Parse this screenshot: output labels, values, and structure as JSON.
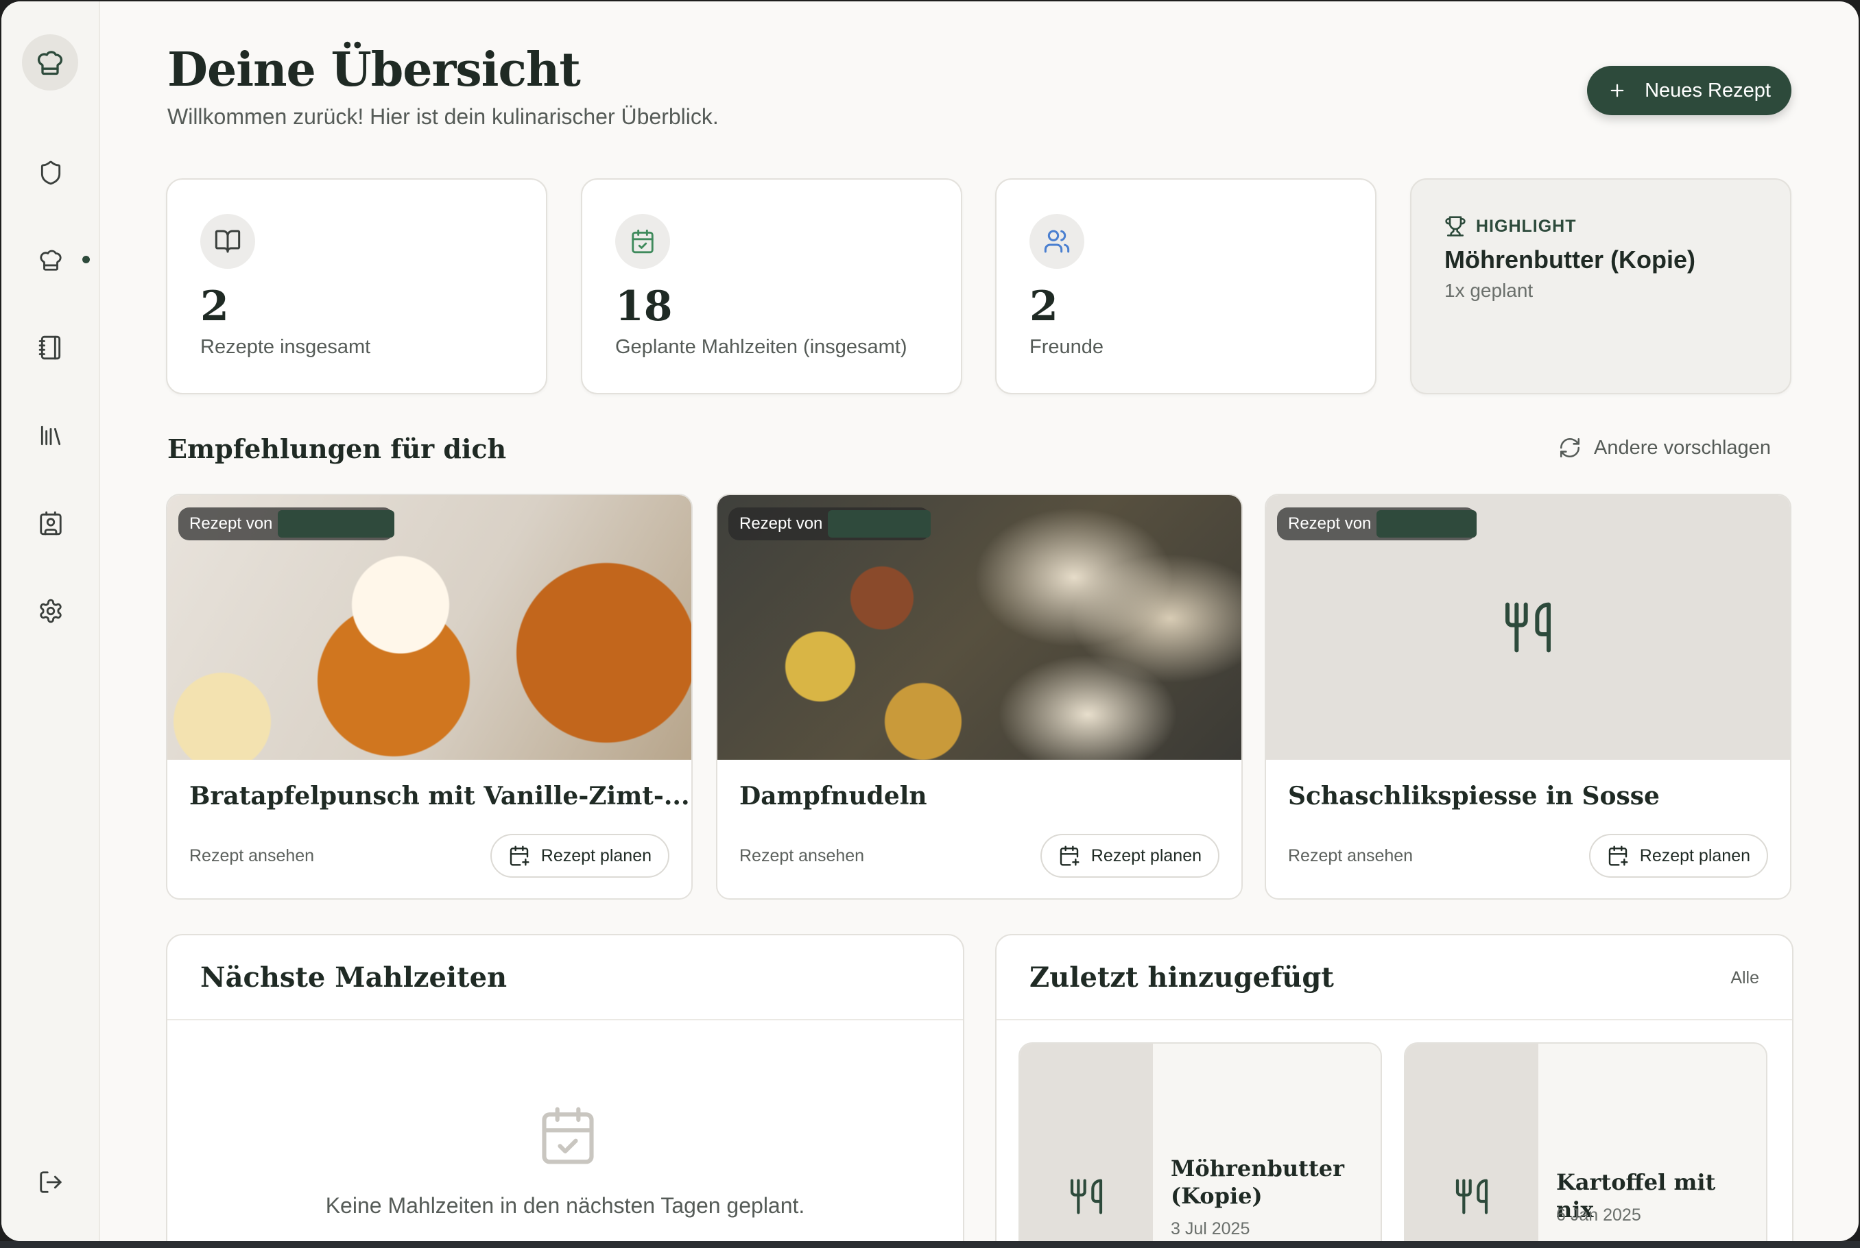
{
  "header": {
    "title": "Deine Übersicht",
    "subtitle": "Willkommen zurück! Hier ist dein kulinarischer Überblick.",
    "new_recipe_label": "Neues Rezept"
  },
  "sidebar": {
    "items": [
      {
        "icon": "shield-icon"
      },
      {
        "icon": "chef-hat-icon",
        "active": true
      },
      {
        "icon": "notebook-icon"
      },
      {
        "icon": "library-icon"
      },
      {
        "icon": "contact-book-icon"
      },
      {
        "icon": "gear-icon"
      },
      {
        "icon": "logout-icon"
      }
    ]
  },
  "stats": [
    {
      "value": "2",
      "label": "Rezepte insgesamt",
      "icon": "book-icon"
    },
    {
      "value": "18",
      "label": "Geplante Mahlzeiten (insgesamt)",
      "icon": "calendar-check-icon"
    },
    {
      "value": "2",
      "label": "Freunde",
      "icon": "users-icon"
    }
  ],
  "highlight": {
    "tag": "HIGHLIGHT",
    "title": "Möhrenbutter (Kopie)",
    "subtitle": "1x geplant"
  },
  "recommendations": {
    "title": "Empfehlungen für dich",
    "refresh_label": "Andere vorschlagen",
    "cards": [
      {
        "badge": "Rezept von",
        "title": "Bratapfelpunsch mit Vanille-Zimt-...",
        "view_label": "Rezept ansehen",
        "plan_label": "Rezept planen"
      },
      {
        "badge": "Rezept von",
        "title": "Dampfnudeln",
        "view_label": "Rezept ansehen",
        "plan_label": "Rezept planen"
      },
      {
        "badge": "Rezept von",
        "title": "Schaschlikspiesse in Sosse",
        "view_label": "Rezept ansehen",
        "plan_label": "Rezept planen"
      }
    ]
  },
  "next_meals": {
    "title": "Nächste Mahlzeiten",
    "empty_text": "Keine Mahlzeiten in den nächsten Tagen geplant."
  },
  "recent": {
    "title": "Zuletzt hinzugefügt",
    "all_label": "Alle",
    "items": [
      {
        "title": "Möhrenbutter (Kopie)",
        "date": "3 Jul 2025"
      },
      {
        "title": "Kartoffel mit nix",
        "date": "6 Jan 2025"
      }
    ]
  },
  "colors": {
    "brand": "#2d4a3b",
    "background": "#faf9f7",
    "card_border": "#e3e1dc"
  }
}
